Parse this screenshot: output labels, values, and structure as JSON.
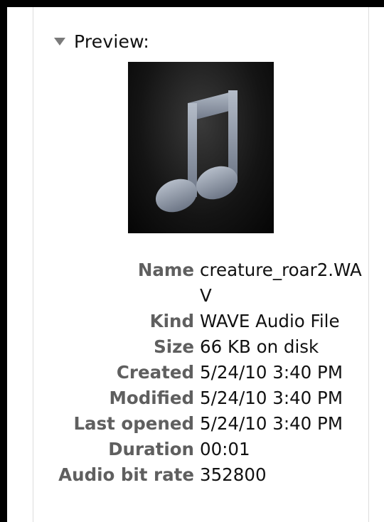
{
  "preview": {
    "label": "Preview:",
    "expanded": true,
    "thumbnail_icon": "music-note-icon"
  },
  "info": {
    "fields": [
      {
        "label": "Name",
        "value": "creature_roar2.WAV"
      },
      {
        "label": "Kind",
        "value": "WAVE Audio File"
      },
      {
        "label": "Size",
        "value": "66 KB on disk"
      },
      {
        "label": "Created",
        "value": "5/24/10 3:40 PM"
      },
      {
        "label": "Modified",
        "value": "5/24/10 3:40 PM"
      },
      {
        "label": "Last opened",
        "value": "5/24/10 3:40 PM"
      },
      {
        "label": "Duration",
        "value": "00:01"
      },
      {
        "label": "Audio bit rate",
        "value": "352800"
      }
    ]
  },
  "colors": {
    "label_text": "#5f5f5f",
    "value_text": "#111111",
    "thumbnail_bg": "#0a0a0a",
    "note_fill": "#8a93a3",
    "frame": "#000000"
  }
}
